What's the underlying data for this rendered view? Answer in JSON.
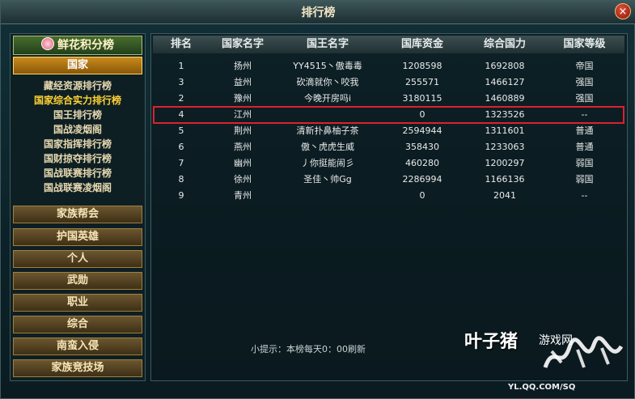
{
  "window": {
    "title": "排行榜",
    "close_label": "×"
  },
  "sidebar": {
    "header": "鲜花积分榜",
    "active_category": "国家",
    "sub_items": [
      {
        "label": "藏经资源排行榜",
        "selected": false
      },
      {
        "label": "国家综合实力排行榜",
        "selected": true
      },
      {
        "label": "国王排行榜",
        "selected": false
      },
      {
        "label": "国战凌烟阁",
        "selected": false
      },
      {
        "label": "国家指挥排行榜",
        "selected": false
      },
      {
        "label": "国财掠夺排行榜",
        "selected": false
      },
      {
        "label": "国战联赛排行榜",
        "selected": false
      },
      {
        "label": "国战联赛凌烟阁",
        "selected": false
      }
    ],
    "categories": [
      "家族帮会",
      "护国英雄",
      "个人",
      "武勋",
      "职业",
      "综合",
      "南蛮入侵",
      "家族竞技场"
    ]
  },
  "table": {
    "columns": [
      "排名",
      "国家名字",
      "国王名字",
      "国库资金",
      "综合国力",
      "国家等级"
    ],
    "rows": [
      [
        "1",
        "扬州",
        "YY4515丶傲毒毒",
        "1208598",
        "1692808",
        "帝国"
      ],
      [
        "3",
        "益州",
        "砍滴就你丶咬我",
        "255571",
        "1466127",
        "强国"
      ],
      [
        "2",
        "豫州",
        "今晚开房吗i",
        "3180115",
        "1460889",
        "强国"
      ],
      [
        "4",
        "江州",
        "",
        "0",
        "1323526",
        "--"
      ],
      [
        "5",
        "荆州",
        "清新扑鼻柚子茶",
        "2594944",
        "1311601",
        "普通"
      ],
      [
        "6",
        "燕州",
        "傲丶虎虎生威",
        "358430",
        "1233063",
        "普通"
      ],
      [
        "7",
        "幽州",
        "丿你挺能闹彡",
        "460280",
        "1200297",
        "弱国"
      ],
      [
        "8",
        "徐州",
        "圣佳丶帅Gg",
        "2286994",
        "1166136",
        "弱国"
      ],
      [
        "9",
        "青州",
        "",
        "0",
        "2041",
        "--"
      ]
    ],
    "highlight_color": "#e0202c"
  },
  "tip": "小提示：本榜每天0：00刷新",
  "watermark": {
    "site": "叶子猪",
    "label": "游戏网",
    "url": "YL.QQ.COM/SQ"
  }
}
